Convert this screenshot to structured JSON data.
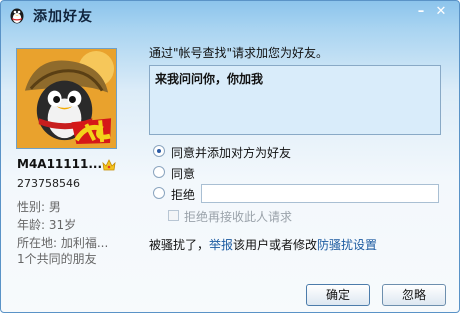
{
  "window": {
    "title": "添加好友"
  },
  "profile": {
    "nickname": "M4A11111...",
    "uid": "273758546",
    "sex": "性别: 男",
    "age": "年龄: 31岁",
    "location": "所在地: 加利福...",
    "mutual_friends": "1个共同的朋友"
  },
  "request": {
    "label": "通过\"帐号查找\"请求加您为好友。",
    "message": "来我问问你，你加我"
  },
  "options": {
    "agree_add": "同意并添加对方为好友",
    "agree": "同意",
    "reject": "拒绝",
    "reject_reason_value": "",
    "block_future": "拒绝再接收此人请求"
  },
  "harass": {
    "prefix": "被骚扰了，",
    "report_link": "举报",
    "middle": "该用户或者修改",
    "settings_link": "防骚扰设置"
  },
  "buttons": {
    "ok": "确定",
    "ignore": "忽略"
  },
  "colors": {
    "accent": "#1b5aa0",
    "title_bar": "#8cc4ec",
    "message_bg": "#d9ecfa"
  },
  "icons": {
    "app": "penguin-icon",
    "vip": "crown-icon",
    "avatar": "game-character-avatar"
  }
}
